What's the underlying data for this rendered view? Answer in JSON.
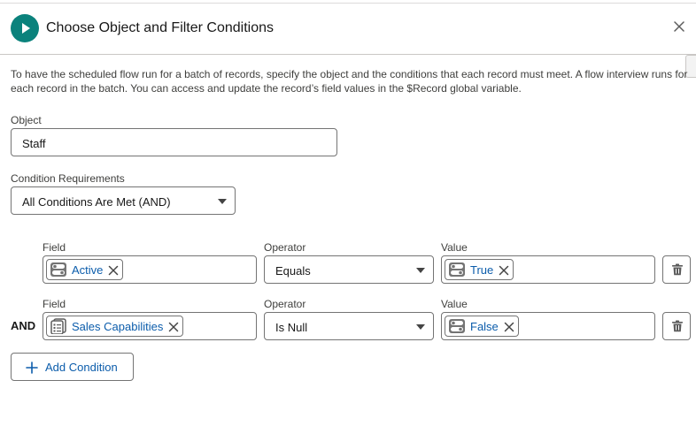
{
  "header": {
    "title": "Choose Object and Filter Conditions"
  },
  "description": "To have the scheduled flow run for a batch of records, specify the object and the conditions that each record must meet. A flow interview runs for each record in the batch. You can access and update the record’s field values in the $Record global variable.",
  "object": {
    "label": "Object",
    "value": "Staff"
  },
  "condition_requirements": {
    "label": "Condition Requirements",
    "value": "All Conditions Are Met (AND)"
  },
  "conditions": [
    {
      "field_label": "Field",
      "field_value": "Active",
      "field_icon": "toggle-icon",
      "operator_label": "Operator",
      "operator_value": "Equals",
      "value_label": "Value",
      "value_value": "True",
      "value_icon": "toggle-icon"
    },
    {
      "connector": "AND",
      "field_label": "Field",
      "field_value": "Sales Capabilities",
      "field_icon": "multi-picklist-icon",
      "operator_label": "Operator",
      "operator_value": "Is Null",
      "value_label": "Value",
      "value_value": "False",
      "value_icon": "toggle-icon"
    }
  ],
  "add_condition_label": "Add Condition",
  "colors": {
    "brand_teal": "#0b827c",
    "link_blue": "#0b5cab",
    "border": "#747474"
  }
}
